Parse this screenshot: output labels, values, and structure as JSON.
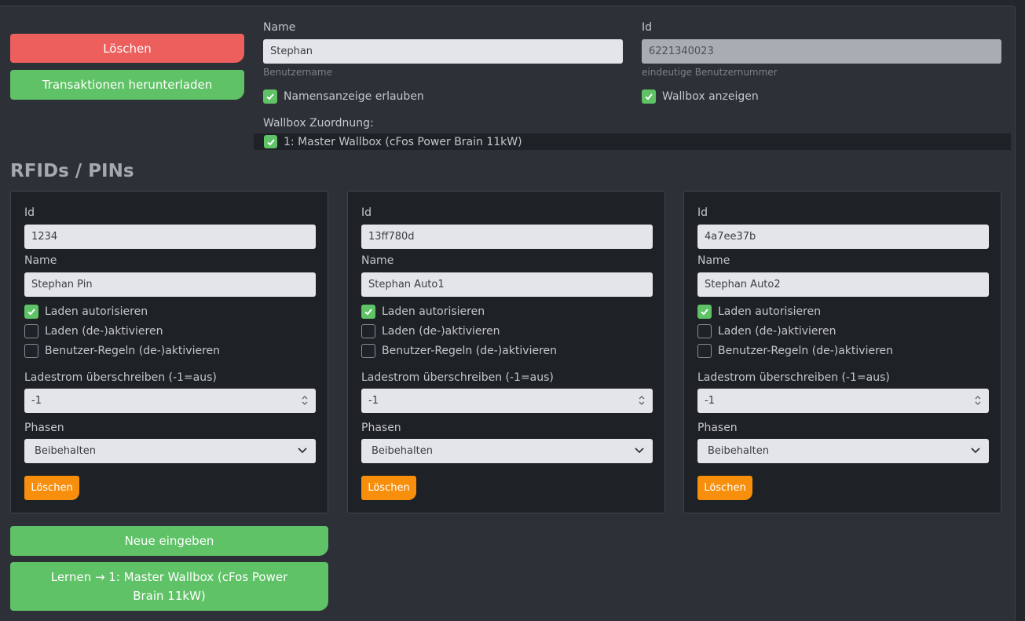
{
  "actions": {
    "delete_label": "Löschen",
    "download_label": "Transaktionen herunterladen"
  },
  "user": {
    "name_label": "Name",
    "name_value": "Stephan",
    "name_hint": "Benutzername",
    "id_label": "Id",
    "id_value": "6221340023",
    "id_hint": "eindeutige Benutzernummer",
    "show_name_label": "Namensanzeige erlauben",
    "show_name_checked": true,
    "show_wallbox_label": "Wallbox anzeigen",
    "show_wallbox_checked": true,
    "wallbox_assign_label": "Wallbox Zuordnung:",
    "wallbox_item_label": "1: Master Wallbox (cFos Power Brain 11kW)",
    "wallbox_item_checked": true
  },
  "rfids": {
    "heading": "RFIDs / PINs",
    "cards": [
      {
        "id_label": "Id",
        "id_value": "1234",
        "name_label": "Name",
        "name_value": "Stephan Pin",
        "charge_auth_label": "Laden autorisieren",
        "charge_auth": true,
        "charge_toggle_label": "Laden (de-)aktivieren",
        "charge_toggle": false,
        "rules_toggle_label": "Benutzer-Regeln (de-)aktivieren",
        "rules_toggle": false,
        "current_label": "Ladestrom überschreiben (-1=aus)",
        "current_value": "-1",
        "phases_label": "Phasen",
        "phases_value": "Beibehalten",
        "delete_label": "Löschen"
      },
      {
        "id_label": "Id",
        "id_value": "13ff780d",
        "name_label": "Name",
        "name_value": "Stephan Auto1",
        "charge_auth_label": "Laden autorisieren",
        "charge_auth": true,
        "charge_toggle_label": "Laden (de-)aktivieren",
        "charge_toggle": false,
        "rules_toggle_label": "Benutzer-Regeln (de-)aktivieren",
        "rules_toggle": false,
        "current_label": "Ladestrom überschreiben (-1=aus)",
        "current_value": "-1",
        "phases_label": "Phasen",
        "phases_value": "Beibehalten",
        "delete_label": "Löschen"
      },
      {
        "id_label": "Id",
        "id_value": "4a7ee37b",
        "name_label": "Name",
        "name_value": "Stephan Auto2",
        "charge_auth_label": "Laden autorisieren",
        "charge_auth": true,
        "charge_toggle_label": "Laden (de-)aktivieren",
        "charge_toggle": false,
        "rules_toggle_label": "Benutzer-Regeln (de-)aktivieren",
        "rules_toggle": false,
        "current_label": "Ladestrom überschreiben (-1=aus)",
        "current_value": "-1",
        "phases_label": "Phasen",
        "phases_value": "Beibehalten",
        "delete_label": "Löschen"
      }
    ],
    "new_label": "Neue eingeben",
    "learn_label": "Lernen → 1: Master Wallbox (cFos Power Brain 11kW)"
  },
  "colors": {
    "danger": "#ed5f5c",
    "success": "#5fc266",
    "warning": "#f78f0d"
  }
}
